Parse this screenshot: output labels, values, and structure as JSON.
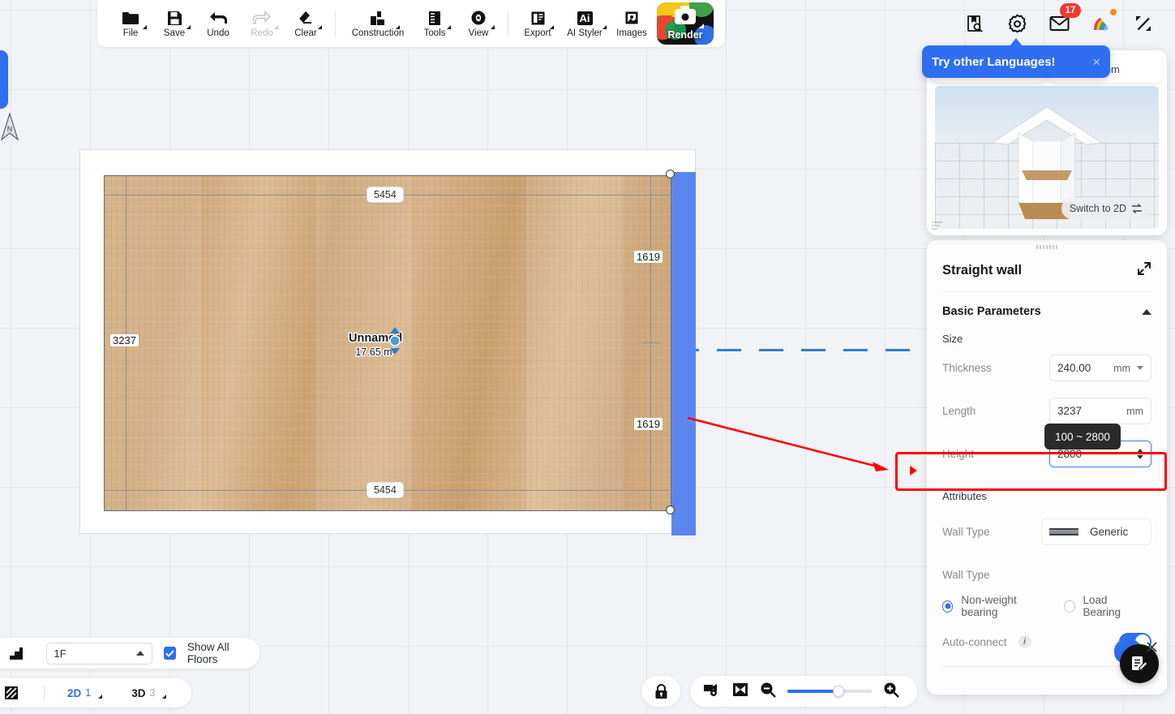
{
  "toolbar": {
    "items": [
      {
        "label": "File",
        "icon": "folder-icon",
        "disabled": false
      },
      {
        "label": "Save",
        "icon": "save-disk-icon",
        "disabled": false
      },
      {
        "label": "Undo",
        "icon": "undo-arrow-icon",
        "disabled": false
      },
      {
        "label": "Redo",
        "icon": "redo-arrow-icon",
        "disabled": true
      },
      {
        "label": "Clear",
        "icon": "eraser-icon",
        "disabled": false
      },
      {
        "label": "Construction",
        "icon": "construction-icon",
        "disabled": false
      },
      {
        "label": "Tools",
        "icon": "ruler-tools-icon",
        "disabled": false
      },
      {
        "label": "View",
        "icon": "eye-view-icon",
        "disabled": false
      },
      {
        "label": "Export",
        "icon": "export-icon",
        "disabled": false
      },
      {
        "label": "AI Styler",
        "icon": "ai-styler-icon",
        "disabled": false
      },
      {
        "label": "Images",
        "icon": "images-icon",
        "disabled": false
      }
    ],
    "render_label": "Render"
  },
  "topright": {
    "icons": [
      "book-search-icon",
      "gear-icon",
      "mail-icon",
      "palette-fan-icon",
      "fullscreen-icon"
    ],
    "mail_badge": "17"
  },
  "language_popup": {
    "text": "Try other Languages!",
    "close": "×"
  },
  "preview": {
    "tab_left": "",
    "tab_right": "Room",
    "switch_label": "Switch to 2D"
  },
  "panel": {
    "title": "Straight wall",
    "section_title": "Basic Parameters",
    "size_label": "Size",
    "thickness_label": "Thickness",
    "thickness_value": "240.00",
    "thickness_unit": "mm",
    "length_label": "Length",
    "length_value": "3237",
    "length_unit": "mm",
    "height_label": "Height",
    "height_value": "2800",
    "tooltip": "100 ~ 2800",
    "attributes_label": "Attributes",
    "wall_type_label": "Wall Type",
    "wall_type_value": "Generic",
    "wall_type_label2": "Wall Type",
    "radio_non_weight": "Non-weight bearing",
    "radio_load_bearing": "Load Bearing",
    "auto_connect_label": "Auto-connect",
    "info_glyph": "i"
  },
  "plan": {
    "dim_top": "5454",
    "dim_bottom": "5454",
    "dim_left": "3237",
    "dim_right_top": "1619",
    "dim_right_bottom": "1619",
    "room_name": "Unnamed",
    "room_area": "17.65 m²"
  },
  "floorbar": {
    "floor_value": "1F",
    "show_all_floors": "Show All Floors"
  },
  "viewbar": {
    "mode_2d": "2D",
    "count_2d": "1",
    "mode_3d": "3D",
    "count_3d": "3"
  },
  "colors": {
    "accent": "#2f6ef0",
    "selection": "#5b86f0",
    "highlight_box": "#ff0000",
    "badge": "#f4382f"
  }
}
